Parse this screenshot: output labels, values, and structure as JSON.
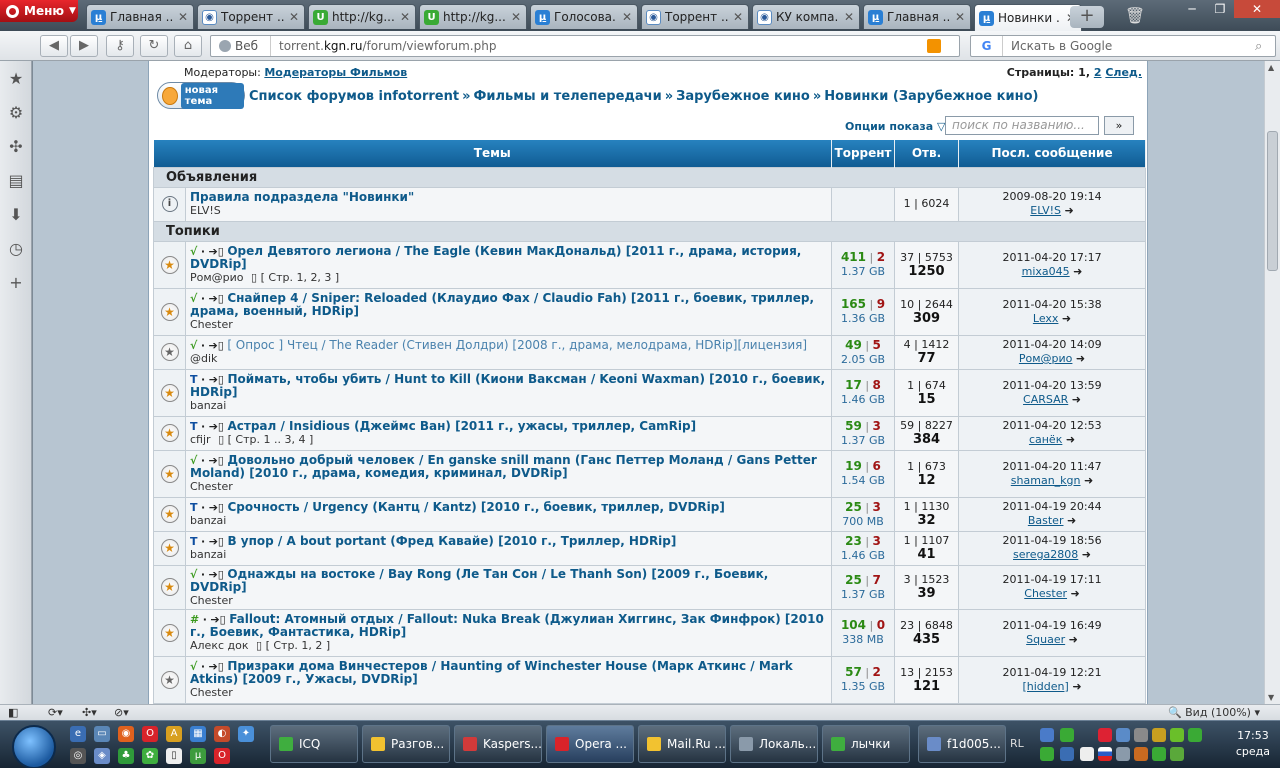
{
  "browser": {
    "menu_label": "Меню",
    "tabs": [
      {
        "title": "Главная ...",
        "icon": "u"
      },
      {
        "title": "Торрент ...",
        "icon": "b"
      },
      {
        "title": "http://kg...",
        "icon": "g"
      },
      {
        "title": "http://kg...",
        "icon": "g"
      },
      {
        "title": "Голосова...",
        "icon": "u"
      },
      {
        "title": "Торрент ...",
        "icon": "b"
      },
      {
        "title": "КУ компа...",
        "icon": "b"
      },
      {
        "title": "Главная ...",
        "icon": "u"
      },
      {
        "title": "Новинки ...",
        "icon": "u"
      }
    ],
    "address_prefix": "Веб",
    "url_host_pre": "torrent.",
    "url_host": "kgn.ru",
    "url_path": "/forum/viewforum.php",
    "search_placeholder": "Искать в Google",
    "search_engine": "G"
  },
  "forum": {
    "moderators_label": "Модераторы:",
    "moderators_link": "Модераторы Фильмов",
    "pages_label": "Страницы:",
    "pages_current": "1",
    "pages_next_page": "2",
    "pages_next": "След.",
    "new_topic_label": "новая тема",
    "breadcrumbs": [
      "Список форумов infotorrent",
      "Фильмы и телепередачи",
      "Зарубежное кино",
      "Новинки (Зарубежное кино)"
    ],
    "crumb_sep": "»",
    "options_label": "Опции показа",
    "search_placeholder": "поиск по названию...",
    "search_button": "»",
    "columns": {
      "topics": "Темы",
      "torrent": "Торрент",
      "replies": "Отв.",
      "last": "Посл. сообщение"
    },
    "announcements_label": "Объявления",
    "topics_label": "Топики",
    "announcement": {
      "title": "Правила подраздела \"Новинки\"",
      "author": "ELV!S",
      "replies": "1 | 6024",
      "last_date": "2009-08-20 19:14",
      "last_user": "ELV!S"
    },
    "topics": [
      {
        "status": "√",
        "title": "Орел Девятого легиона / The Eagle (Кевин МакДональд) [2011 г., драма, история, DVDRip]",
        "author": "Ром@рио",
        "pages": "[ Стр. 1, 2, 3 ]",
        "seeds": "411",
        "leech": "2",
        "size": "1.37 GB",
        "rv": "37 | 5753",
        "dl": "1250",
        "date": "2011-04-20 17:17",
        "user": "mixa045"
      },
      {
        "status": "√",
        "title": "Снайпер 4 / Sniper: Reloaded (Клаудио Фах / Claudio Fah) [2011 г., боевик, триллер, драма, военный, HDRip]",
        "author": "Chester",
        "pages": "",
        "seeds": "165",
        "leech": "9",
        "size": "1.36 GB",
        "rv": "10 | 2644",
        "dl": "309",
        "date": "2011-04-20 15:38",
        "user": "Lexx"
      },
      {
        "status": "√",
        "title": "[ Опрос ] Чтец / The Reader (Стивен Долдри) [2008 г., драма, мелодрама, HDRip][лицензия]",
        "author": "@dik",
        "pages": "",
        "seeds": "49",
        "leech": "5",
        "size": "2.05 GB",
        "rv": "4 | 1412",
        "dl": "77",
        "date": "2011-04-20 14:09",
        "user": "Ром@рио"
      },
      {
        "status": "T",
        "title": "Поймать, чтобы убить / Hunt to Kill (Киони Ваксман / Keoni Waxman) [2010 г., боевик, HDRip]",
        "author": "banzai",
        "pages": "",
        "seeds": "17",
        "leech": "8",
        "size": "1.46 GB",
        "rv": "1 | 674",
        "dl": "15",
        "date": "2011-04-20 13:59",
        "user": "CARSAR"
      },
      {
        "status": "T",
        "title": "Астрал / Insidious (Джеймс Ван) [2011 г., ужасы, триллер, CamRip]",
        "author": "cfijr",
        "pages": "[ Стр. 1 .. 3, 4 ]",
        "seeds": "59",
        "leech": "3",
        "size": "1.37 GB",
        "rv": "59 | 8227",
        "dl": "384",
        "date": "2011-04-20 12:53",
        "user": "санёк"
      },
      {
        "status": "√",
        "title": "Довольно добрый человек / En ganske snill mann (Ганс Петтер Моланд / Gans Petter Moland) [2010 г., драма, комедия, криминал, DVDRip]",
        "author": "Chester",
        "pages": "",
        "seeds": "19",
        "leech": "6",
        "size": "1.54 GB",
        "rv": "1 | 673",
        "dl": "12",
        "date": "2011-04-20 11:47",
        "user": "shaman_kgn"
      },
      {
        "status": "T",
        "title": "Срочность / Urgency (Кантц / Kantz) [2010 г., боевик, триллер, DVDRip]",
        "author": "banzai",
        "pages": "",
        "seeds": "25",
        "leech": "3",
        "size": "700 MB",
        "rv": "1 | 1130",
        "dl": "32",
        "date": "2011-04-19 20:44",
        "user": "Baster"
      },
      {
        "status": "T",
        "title": "В упор / A bout portant (Фред Кавайе) [2010 г., Триллер, HDRip]",
        "author": "banzai",
        "pages": "",
        "seeds": "23",
        "leech": "3",
        "size": "1.46 GB",
        "rv": "1 | 1107",
        "dl": "41",
        "date": "2011-04-19 18:56",
        "user": "serega2808"
      },
      {
        "status": "√",
        "title": "Однажды на востоке / Bay Rong (Ле Тан Сон / Le Thanh Son) [2009 г., Боевик, DVDRip]",
        "author": "Chester",
        "pages": "",
        "seeds": "25",
        "leech": "7",
        "size": "1.37 GB",
        "rv": "3 | 1523",
        "dl": "39",
        "date": "2011-04-19 17:11",
        "user": "Chester"
      },
      {
        "status": "#",
        "title": "Fallout: Атомный отдых / Fallout: Nuka Break (Джулиан Хиггинс, Зак Финфрок) [2010 г., Боевик, Фантастика, HDRip]",
        "author": "Алекс док",
        "pages": "[ Стр. 1, 2 ]",
        "seeds": "104",
        "leech": "0",
        "size": "338 MB",
        "rv": "23 | 6848",
        "dl": "435",
        "date": "2011-04-19 16:49",
        "user": "Squaer"
      },
      {
        "status": "√",
        "title": "Призраки дома Винчестеров / Haunting of Winchester House (Марк Аткинс / Mark Atkins) [2009 г., Ужасы, DVDRip]",
        "author": "Chester",
        "pages": "",
        "seeds": "57",
        "leech": "2",
        "size": "1.35 GB",
        "rv": "13 | 2153",
        "dl": "121",
        "date": "2011-04-19 12:21",
        "user": "[hidden]"
      }
    ]
  },
  "statusbar": {
    "zoom": "Вид (100%)"
  },
  "taskbar": {
    "buttons": [
      "ICQ",
      "Разгов...",
      "Kaspers...",
      "Opera ...",
      "Mail.Ru ...",
      "Локаль...",
      "лычки",
      "f1d005..."
    ],
    "lang": "RL",
    "time": "17:53",
    "day": "среда"
  }
}
